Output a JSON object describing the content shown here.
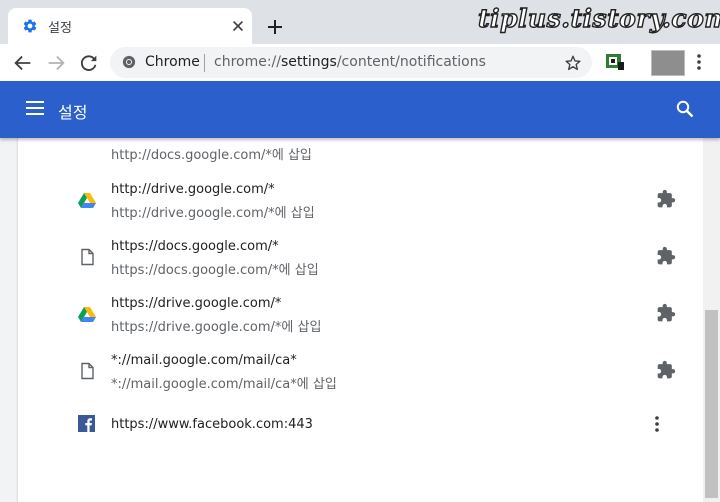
{
  "browser": {
    "tab_title": "설정",
    "watermark": "tiplus.tistory.com",
    "omnibox": {
      "chip_label": "Chrome",
      "url_prefix": "chrome://",
      "url_host": "settings",
      "url_path": "/content/notifications"
    }
  },
  "header": {
    "title": "설정"
  },
  "rows": [
    {
      "icon": "file-icon",
      "subtitle": "http://docs.google.com/*에 삽입",
      "action": "puzzle-icon"
    },
    {
      "icon": "google-drive-icon",
      "pattern": "http://drive.google.com/*",
      "subtitle": "http://drive.google.com/*에 삽입",
      "action": "puzzle-icon"
    },
    {
      "icon": "file-icon",
      "pattern": "https://docs.google.com/*",
      "subtitle": "https://docs.google.com/*에 삽입",
      "action": "puzzle-icon"
    },
    {
      "icon": "google-drive-icon",
      "pattern": "https://drive.google.com/*",
      "subtitle": "https://drive.google.com/*에 삽입",
      "action": "puzzle-icon"
    },
    {
      "icon": "file-icon",
      "pattern": "*://mail.google.com/mail/ca*",
      "subtitle": "*://mail.google.com/mail/ca*에 삽입",
      "action": "puzzle-icon"
    },
    {
      "icon": "facebook-icon",
      "pattern": "https://www.facebook.com:443",
      "action": "more-vert-icon"
    }
  ],
  "colors": {
    "header_blue": "#2a5fcc",
    "tab_strip": "#dee1e6",
    "page_background": "#f1f3f4",
    "facebook_blue": "#3b5998"
  }
}
